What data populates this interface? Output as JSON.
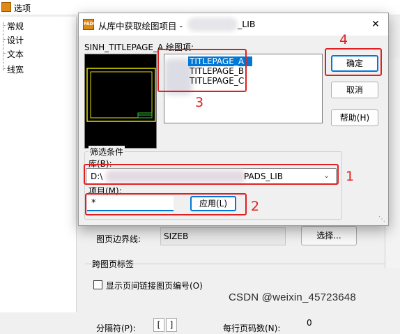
{
  "background_window": {
    "title": "选项",
    "tree": [
      "常规",
      "设计",
      "文本",
      "线宽"
    ],
    "sheet_border_label": "图页边界线:",
    "sheet_border_value": "SIZEB",
    "select_button": "选择...",
    "cross_sheet_group": "跨图页标签",
    "checkbox_label": "显示页间链接图页编号(O)",
    "separator_label": "分隔符(P):",
    "separator_left": "[",
    "separator_right": "]",
    "per_page_label": "每行页码数(N):",
    "per_page_value": "0"
  },
  "dialog": {
    "title_prefix": "从库中获取绘图项目 -",
    "title_suffix": "_LIB",
    "icon_text": "PADS",
    "close_glyph": "✕",
    "preview_label": "SINH_TITLEPAGE_A  绘图项:",
    "items": [
      "TITLEPAGE_A",
      "TITLEPAGE_B",
      "TITLEPAGE_C"
    ],
    "ok_label": "确定",
    "cancel_label": "取消",
    "help_label": "帮助(H)",
    "filter_label": "筛选条件",
    "library_label": "库(B):",
    "library_prefix": "D:\\",
    "library_suffix": "PADS_LIB",
    "item_label": "项目(M):",
    "item_value": "*",
    "apply_label": "应用(L)"
  },
  "annotations": [
    "1",
    "2",
    "3",
    "4"
  ],
  "watermark": "CSDN @weixin_45723648",
  "colors": {
    "accent": "#0078d7",
    "annotation": "#e02020",
    "preview_border": "#e0e000",
    "preview_marker": "#33cc33"
  }
}
